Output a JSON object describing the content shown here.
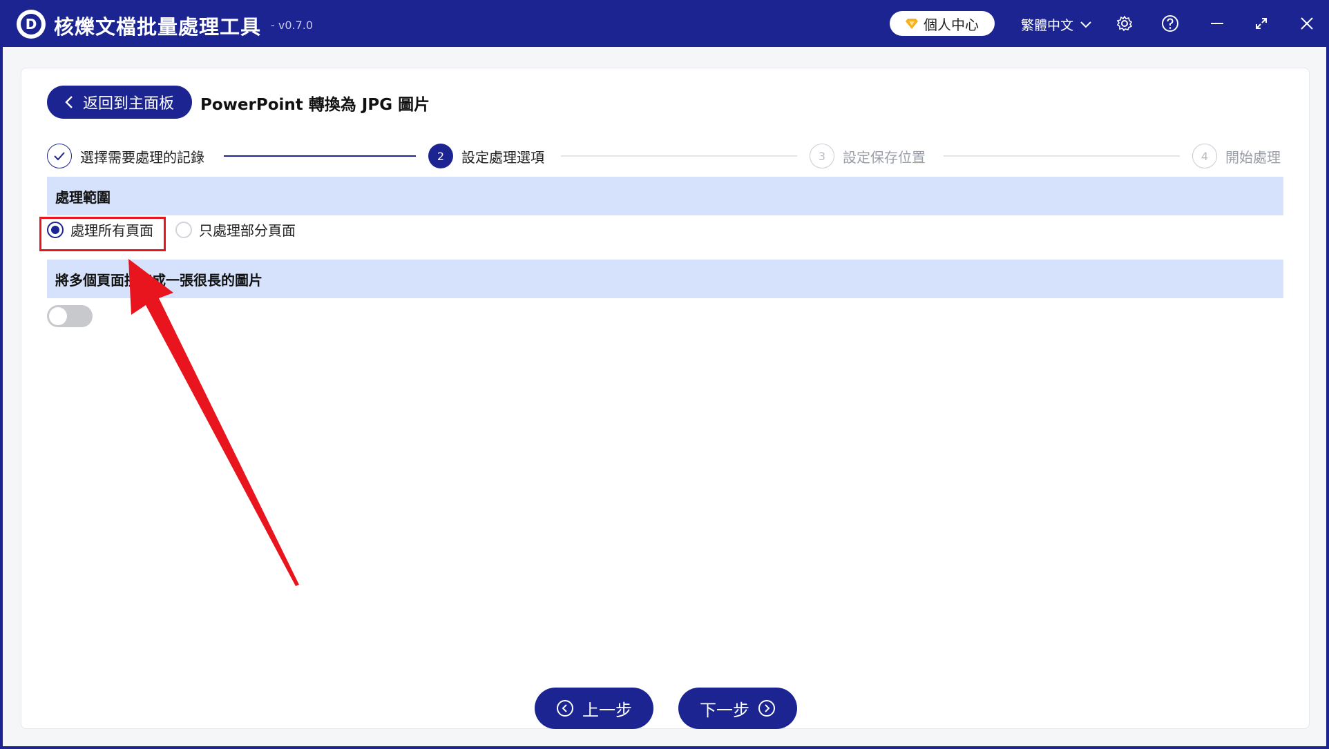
{
  "app": {
    "logo_letter": "D",
    "title": "核爍文檔批量處理工具",
    "version": "- v0.7.0",
    "user_center": "個人中心",
    "language": "繁體中文"
  },
  "header": {
    "back_label": "返回到主面板",
    "page_title": "PowerPoint 轉換為 JPG 圖片"
  },
  "steps": [
    {
      "label": "選擇需要處理的記錄",
      "marker": "✓",
      "state": "done"
    },
    {
      "label": "設定處理選項",
      "marker": "2",
      "state": "active"
    },
    {
      "label": "設定保存位置",
      "marker": "3",
      "state": "pending"
    },
    {
      "label": "開始處理",
      "marker": "4",
      "state": "pending"
    }
  ],
  "range_section": {
    "title": "處理範圍",
    "options": [
      {
        "label": "處理所有頁面",
        "selected": true
      },
      {
        "label": "只處理部分頁面",
        "selected": false
      }
    ]
  },
  "merge_section": {
    "title": "將多個頁面拼接成一張很長的圖片",
    "toggle_on": false
  },
  "footer": {
    "prev_label": "上一步",
    "next_label": "下一步"
  },
  "colors": {
    "brand": "#1b2490",
    "section_bg": "#d6e2fb",
    "annotation": "#e8141e"
  }
}
